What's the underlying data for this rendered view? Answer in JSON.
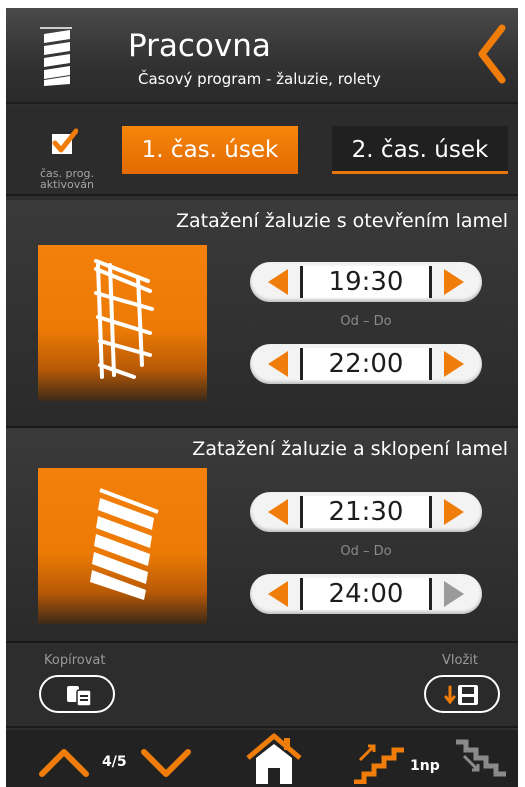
{
  "header": {
    "title": "Pracovna",
    "subtitle": "Časový program - žaluzie, rolety",
    "icons": {
      "room": "blind-icon",
      "back": "back-chevron-icon"
    }
  },
  "tabs": {
    "checkbox_label_line1": "čas. prog.",
    "checkbox_label_line2": "aktivován",
    "checkbox_checked": true,
    "items": [
      {
        "label": "1. čas. úsek",
        "active": true
      },
      {
        "label": "2. čas. úsek",
        "active": false
      }
    ]
  },
  "sections": [
    {
      "title": "Zatažení žaluzie s otevřením lamel",
      "from": "19:30",
      "caption": "Od – Do",
      "to": "22:00",
      "icon": "blind-open-slats-icon"
    },
    {
      "title": "Zatažení žaluzie a sklopení lamel",
      "from": "21:30",
      "caption": "Od – Do",
      "to": "24:00",
      "icon": "blind-tilted-slats-icon"
    }
  ],
  "copy_paste": {
    "copy_label": "Kopírovat",
    "paste_label": "Vložit"
  },
  "footer": {
    "page": "4/5",
    "floor": "1np"
  },
  "colors": {
    "accent": "#e8750a",
    "background": "#2e2e2e"
  }
}
